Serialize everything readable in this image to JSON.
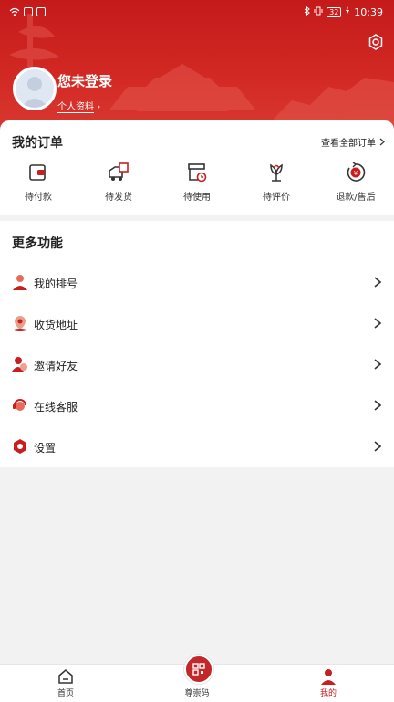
{
  "status": {
    "time": "10:39",
    "battery": "32"
  },
  "header": {
    "username": "您未登录",
    "profile_link": "个人资料"
  },
  "orders": {
    "title": "我的订单",
    "view_all": "查看全部订单",
    "items": [
      {
        "label": "待付款",
        "icon": "wallet-icon"
      },
      {
        "label": "待发货",
        "icon": "delivery-truck-icon"
      },
      {
        "label": "待使用",
        "icon": "box-clock-icon"
      },
      {
        "label": "待评价",
        "icon": "flower-icon"
      },
      {
        "label": "退款/售后",
        "icon": "refund-icon"
      }
    ]
  },
  "more": {
    "title": "更多功能",
    "items": [
      {
        "label": "我的排号",
        "icon": "person-icon"
      },
      {
        "label": "收货地址",
        "icon": "location-person-icon"
      },
      {
        "label": "邀请好友",
        "icon": "invite-friends-icon"
      },
      {
        "label": "在线客服",
        "icon": "headset-icon"
      },
      {
        "label": "设置",
        "icon": "settings-hexagon-icon"
      }
    ]
  },
  "tabbar": [
    {
      "label": "首页",
      "icon": "home-icon"
    },
    {
      "label": "尊崇码",
      "icon": "qr-code-icon"
    },
    {
      "label": "我的",
      "icon": "profile-icon"
    }
  ],
  "colors": {
    "brand": "#c81e1e",
    "background": "#f2f2f2"
  }
}
